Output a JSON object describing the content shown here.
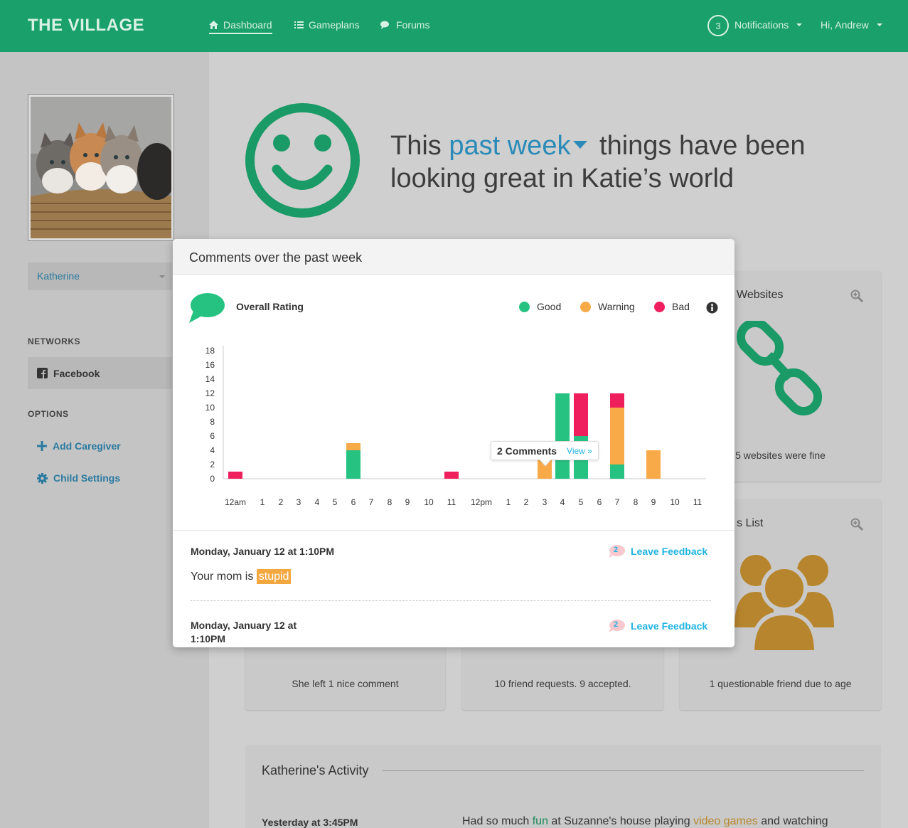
{
  "nav": {
    "brand": "THE VILLAGE",
    "items": [
      {
        "label": "Dashboard",
        "icon": "home-icon",
        "active": true
      },
      {
        "label": "Gameplans",
        "icon": "list-icon",
        "active": false
      },
      {
        "label": "Forums",
        "icon": "chat-icon",
        "active": false
      }
    ],
    "notifications_count": "3",
    "notifications_label": "Notifications",
    "user_label": "Hi, Andrew"
  },
  "sidebar": {
    "child_name": "Katherine",
    "networks_heading": "NETWORKS",
    "network_item": "Facebook",
    "options_heading": "OPTIONS",
    "add_caregiver": "Add Caregiver",
    "child_settings": "Child Settings"
  },
  "hero": {
    "prefix": "This ",
    "period": "past week",
    "suffix": " things have been looking great in Katie’s world"
  },
  "cards": {
    "websites_title": "Websites",
    "websites_foot": "5 websites were fine",
    "list_title": "s List",
    "comments_foot": "She left 1 nice comment",
    "friends_foot": "10 friend requests. 9 accepted.",
    "questionable_foot": "1 questionable friend due to age"
  },
  "activity": {
    "title": "Katherine's Activity",
    "date": "Yesterday at 3:45PM",
    "text_before": "Had so much ",
    "text_hl1": "fun",
    "text_mid": " at Suzanne's house playing ",
    "text_hl2": "video games",
    "text_after": " and watching"
  },
  "modal": {
    "title": "Comments over the past week",
    "rating_label": "Overall Rating",
    "legend": [
      {
        "label": "Good",
        "color": "#26c281"
      },
      {
        "label": "Warning",
        "color": "#f7aa47"
      },
      {
        "label": "Bad",
        "color": "#ee1f5c"
      }
    ],
    "tooltip": {
      "count": "2 Comments",
      "link": "View »"
    },
    "comments": [
      {
        "date": "Monday, January 12 at 1:10PM",
        "feedback_count": "2",
        "feedback_label": "Leave Feedback",
        "text_before": "Your mom is ",
        "text_flag": "stupid"
      },
      {
        "date": "Monday, January 12 at 1:10PM",
        "feedback_count": "2",
        "feedback_label": "Leave Feedback"
      }
    ]
  },
  "chart_data": {
    "type": "bar",
    "stacked": true,
    "categories": [
      "12am",
      "1",
      "2",
      "3",
      "4",
      "5",
      "6",
      "7",
      "8",
      "9",
      "10",
      "11",
      "12pm",
      "1",
      "2",
      "3",
      "4",
      "5",
      "6",
      "7",
      "8",
      "9",
      "10",
      "11"
    ],
    "yticks": [
      0,
      2,
      4,
      6,
      8,
      10,
      12,
      14,
      16,
      18
    ],
    "ylim": [
      0,
      18
    ],
    "series": [
      {
        "name": "Good",
        "color": "#26c281",
        "values": [
          0,
          0,
          0,
          0,
          0,
          0,
          4,
          0,
          0,
          0,
          0,
          0,
          0,
          0,
          0,
          0,
          12,
          6,
          0,
          2,
          0,
          0,
          0,
          0
        ]
      },
      {
        "name": "Warning",
        "color": "#f7aa47",
        "values": [
          0,
          0,
          0,
          0,
          0,
          0,
          1,
          0,
          0,
          0,
          0,
          0,
          0,
          0,
          0,
          3,
          0,
          0,
          0,
          8,
          0,
          4,
          0,
          0
        ]
      },
      {
        "name": "Bad",
        "color": "#ee1f5c",
        "values": [
          1,
          0,
          0,
          0,
          0,
          0,
          0,
          0,
          0,
          0,
          0,
          1,
          0,
          0,
          0,
          0,
          0,
          6,
          0,
          2,
          0,
          0,
          0,
          0
        ]
      }
    ]
  }
}
